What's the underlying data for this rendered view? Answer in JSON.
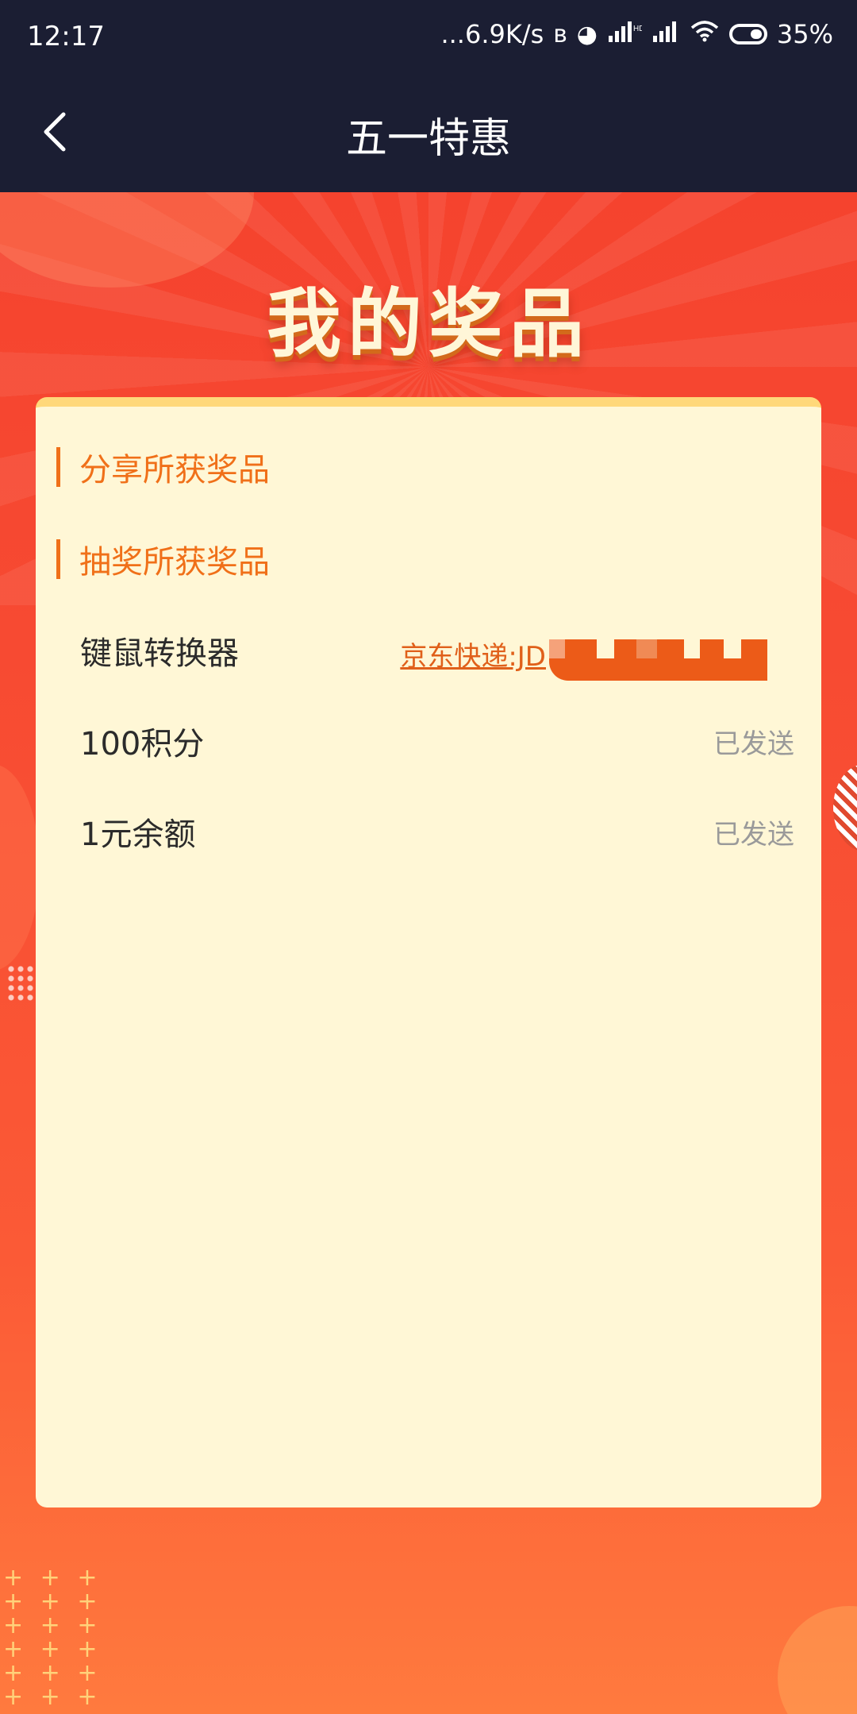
{
  "status_bar": {
    "time": "12:17",
    "network_speed": "...6.9K/s",
    "battery": "35%",
    "icons": [
      "bluetooth-icon",
      "app-notification-icon",
      "signal-icon",
      "signal-icon",
      "wifi-icon",
      "battery-icon"
    ]
  },
  "nav": {
    "title": "五一特惠",
    "back_icon": "chevron-left-icon"
  },
  "hero": {
    "title": "我的奖品"
  },
  "sections": {
    "share_prizes": "分享所获奖品",
    "lottery_prizes": "抽奖所获奖品"
  },
  "prizes": [
    {
      "name": "键鼠转换器",
      "tracking": "京东快递:JD",
      "status": ""
    },
    {
      "name": "100积分",
      "tracking": "",
      "status": "已发送"
    },
    {
      "name": "1元余额",
      "tracking": "",
      "status": "已发送"
    }
  ],
  "colors": {
    "header_bg": "#1b1e33",
    "accent": "#f07019",
    "card_bg": "#fff7d6",
    "hero_red": "#f5432e"
  }
}
